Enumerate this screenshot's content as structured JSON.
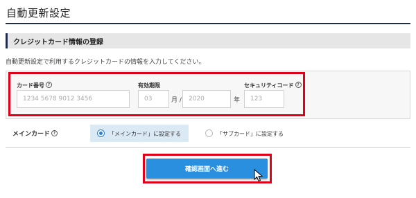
{
  "page": {
    "title": "自動更新設定"
  },
  "section": {
    "title": "クレジットカード情報の登録"
  },
  "description": "自動更新設定で利用するクレジットカードの情報を入力してください。",
  "card_form": {
    "card_number": {
      "label": "カード番号",
      "placeholder": "1234 5678 9012 3456"
    },
    "expiry": {
      "label": "有効期限",
      "month_placeholder": "03",
      "month_unit": "月 /",
      "year_placeholder": "2020",
      "year_unit": "年"
    },
    "security_code": {
      "label": "セキュリティコード",
      "placeholder": "123"
    },
    "help_glyph": "?"
  },
  "main_card": {
    "label": "メインカード",
    "options": [
      {
        "label": "「メインカード」に設定する",
        "selected": true
      },
      {
        "label": "「サブカード」に設定する",
        "selected": false
      }
    ]
  },
  "confirm_button": {
    "label": "確認画面へ進む"
  },
  "colors": {
    "accent": "#2b8fe0",
    "highlight_frame": "#e0001a",
    "header_rule": "#1f2d4a",
    "selected_option_bg": "#dbe9f5"
  },
  "icons": [
    "help-icon",
    "radio-selected-icon",
    "radio-unselected-icon",
    "mouse-pointer-icon"
  ]
}
